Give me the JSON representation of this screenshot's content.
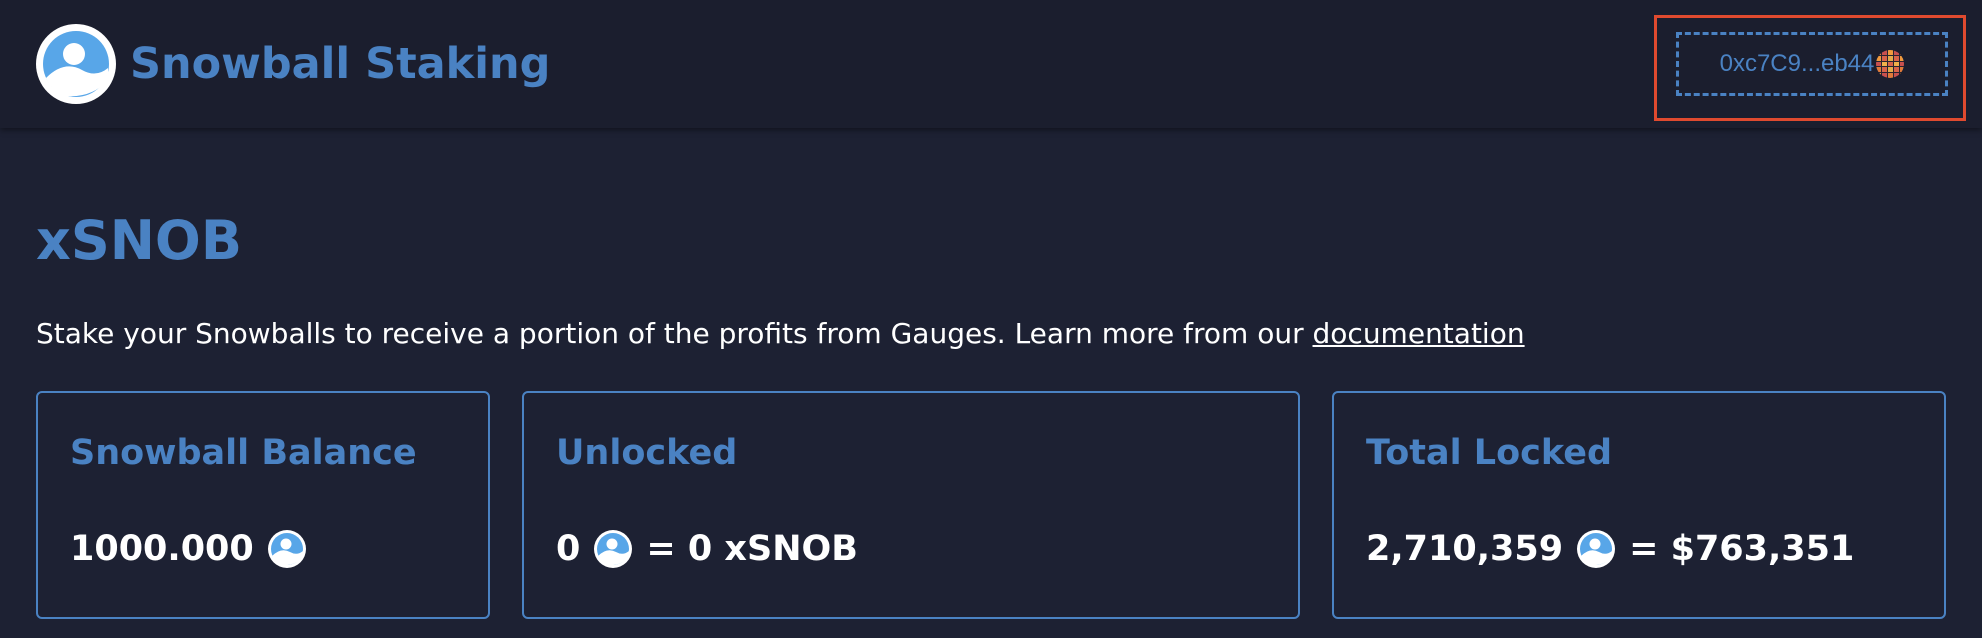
{
  "header": {
    "title": "Snowball Staking",
    "logo_icon": "snowball-logo-icon",
    "wallet": {
      "address": "0xc7C9...eb44",
      "avatar_icon": "wallet-identicon-icon",
      "highlight_color": "#e04a2f"
    }
  },
  "main": {
    "heading": "xSNOB",
    "description": {
      "text": "Stake your Snowballs to receive a portion of the profits from Gauges. Learn more from our ",
      "link_label": "documentation"
    },
    "cards": {
      "balance": {
        "title": "Snowball Balance",
        "amount": "1000.000",
        "coin_icon": "snowball-token-icon"
      },
      "unlocked": {
        "title": "Unlocked",
        "amount": "0",
        "equivalent": "= 0 xSNOB",
        "coin_icon": "snowball-token-icon"
      },
      "total_locked": {
        "title": "Total Locked",
        "amount": "2,710,359",
        "equivalent": "= $763,351",
        "coin_icon": "snowball-token-icon"
      }
    }
  },
  "colors": {
    "background": "#1d2133",
    "header_background": "#1b1e2e",
    "accent": "#4a82c3",
    "text": "#ffffff"
  }
}
